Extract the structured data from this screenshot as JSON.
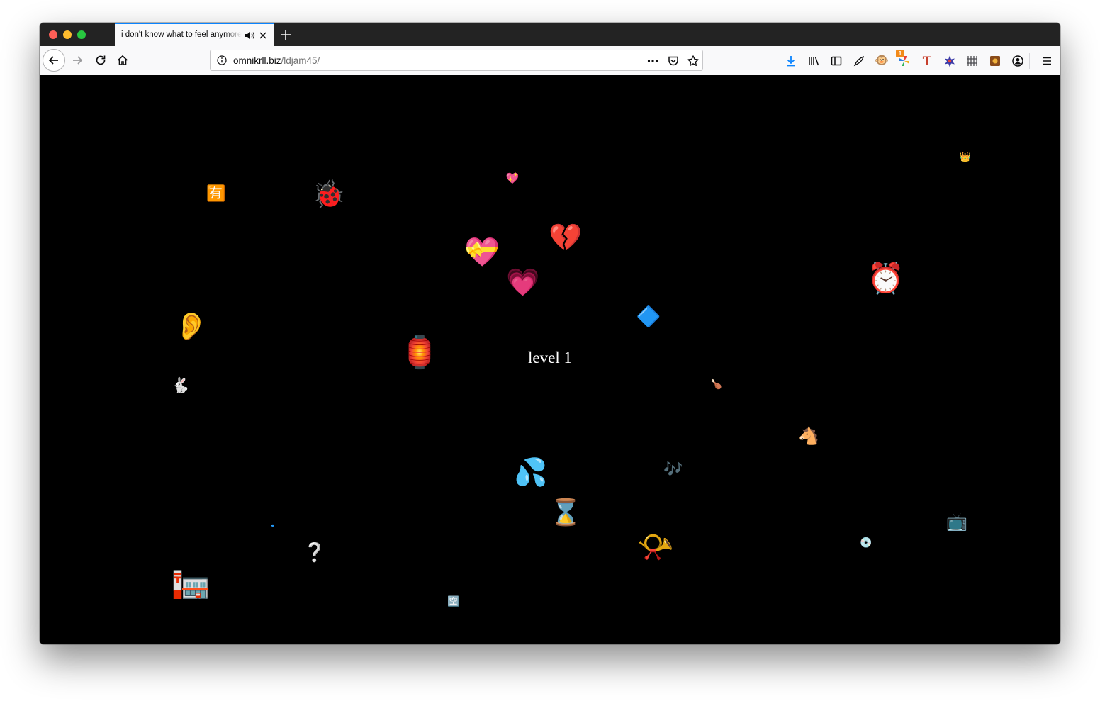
{
  "tab": {
    "title": "i don't know what to feel anymore",
    "sound_icon": "speaker-icon",
    "close_icon": "close-icon"
  },
  "newtab_icon": "plus-icon",
  "nav": {
    "url_domain": "omnikrll.biz",
    "url_path": "/ldjam45/",
    "extension_badge": "1"
  },
  "game": {
    "level_text": "level 1",
    "emojis": [
      {
        "name": "sunglasses-emoji",
        "char": "😎"
      },
      {
        "name": "have-sign-emoji",
        "char": "🈶"
      },
      {
        "name": "ladybug-emoji",
        "char": "🐞"
      },
      {
        "name": "sparkling-heart-emoji",
        "char": "💖"
      },
      {
        "name": "crown-emoji",
        "char": "👑"
      },
      {
        "name": "broken-heart-emoji",
        "char": "💔"
      },
      {
        "name": "heart-ribbon-emoji",
        "char": "💝"
      },
      {
        "name": "growing-heart-emoji",
        "char": "💗"
      },
      {
        "name": "alarm-clock-emoji",
        "char": "⏰"
      },
      {
        "name": "ear-emoji",
        "char": "👂"
      },
      {
        "name": "blue-diamond-emoji",
        "char": "🔷"
      },
      {
        "name": "relieved-face-emoji",
        "char": "😌"
      },
      {
        "name": "lantern-emoji",
        "char": "🏮"
      },
      {
        "name": "rabbit-emoji",
        "char": "🐇"
      },
      {
        "name": "poultry-leg-emoji",
        "char": "🍗"
      },
      {
        "name": "horse-emoji",
        "char": "🐴"
      },
      {
        "name": "sweat-droplets-emoji",
        "char": "💦"
      },
      {
        "name": "music-notes-emoji",
        "char": "🎶"
      },
      {
        "name": "tiny-figure-emoji",
        "char": "⛸"
      },
      {
        "name": "hourglass-emoji",
        "char": "⌛"
      },
      {
        "name": "small-blue-diamond-emoji",
        "char": "🔹"
      },
      {
        "name": "television-emoji",
        "char": "📺"
      },
      {
        "name": "question-mark-emoji",
        "char": "❔"
      },
      {
        "name": "postal-horn-emoji",
        "char": "📯"
      },
      {
        "name": "dvd-emoji",
        "char": "💿"
      },
      {
        "name": "post-office-emoji",
        "char": "🏣"
      },
      {
        "name": "zzz-sign-emoji",
        "char": "🈳"
      },
      {
        "name": "persevering-face-emoji",
        "char": "😣"
      }
    ]
  }
}
